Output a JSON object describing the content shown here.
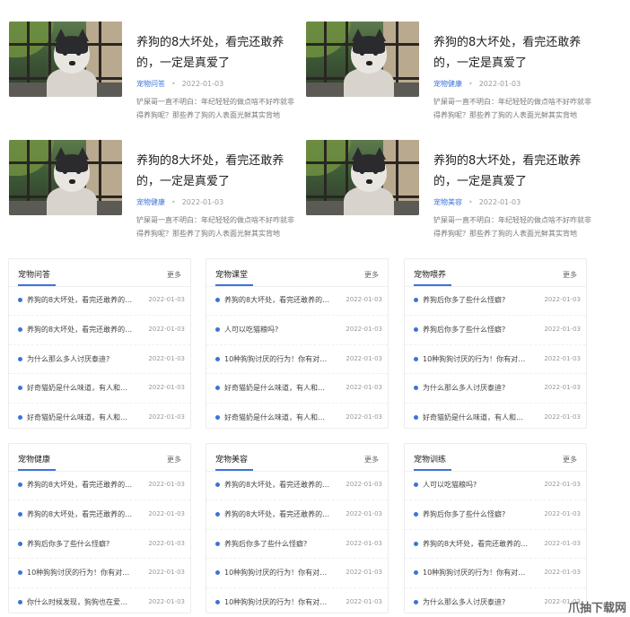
{
  "articles": [
    {
      "title": "养狗的8大坏处，看完还敢养的，一定是真爱了",
      "tag": "宠物问答",
      "date": "2022-01-03",
      "desc": "铲屎哥一直不明白：年纪轻轻的做点啥不好咋就非得养狗呢？那些养了狗的人表面光鲜其实背地"
    },
    {
      "title": "养狗的8大坏处，看完还敢养的，一定是真爱了",
      "tag": "宠物健康",
      "date": "2022-01-03",
      "desc": "铲屎哥一直不明白：年纪轻轻的做点啥不好咋就非得养狗呢？那些养了狗的人表面光鲜其实背地"
    },
    {
      "title": "养狗的8大坏处，看完还敢养的，一定是真爱了",
      "tag": "宠物健康",
      "date": "2022-01-03",
      "desc": "铲屎哥一直不明白：年纪轻轻的做点啥不好咋就非得养狗呢？那些养了狗的人表面光鲜其实背地"
    },
    {
      "title": "养狗的8大坏处，看完还敢养的，一定是真爱了",
      "tag": "宠物美容",
      "date": "2022-01-03",
      "desc": "铲屎哥一直不明白：年纪轻轻的做点啥不好咋就非得养狗呢？那些养了狗的人表面光鲜其实背地"
    }
  ],
  "more_label": "更多",
  "categories": [
    {
      "name": "宠物问答",
      "items": [
        {
          "text": "养狗的8大坏处，看完还敢养的，一...",
          "date": "2022-01-03"
        },
        {
          "text": "养狗的8大坏处，看完还敢养的，一...",
          "date": "2022-01-03"
        },
        {
          "text": "为什么那么多人讨厌泰迪?",
          "date": "2022-01-03"
        },
        {
          "text": "好奇猫奶是什么味道，有人和我一样...",
          "date": "2022-01-03"
        },
        {
          "text": "好奇猫奶是什么味道，有人和我一样...",
          "date": "2022-01-03"
        }
      ]
    },
    {
      "name": "宠物课堂",
      "items": [
        {
          "text": "养狗的8大坏处，看完还敢养的，一...",
          "date": "2022-01-03"
        },
        {
          "text": "人可以吃猫粮吗?",
          "date": "2022-01-03"
        },
        {
          "text": "10种狗狗讨厌的行为！你有对狗狗...",
          "date": "2022-01-03"
        },
        {
          "text": "好奇猫奶是什么味道，有人和我一样...",
          "date": "2022-01-03"
        },
        {
          "text": "好奇猫奶是什么味道，有人和我一样...",
          "date": "2022-01-03"
        }
      ]
    },
    {
      "name": "宠物喂养",
      "items": [
        {
          "text": "养狗后你多了些什么怪癖?",
          "date": "2022-01-03"
        },
        {
          "text": "养狗后你多了些什么怪癖?",
          "date": "2022-01-03"
        },
        {
          "text": "10种狗狗讨厌的行为！你有对狗狗...",
          "date": "2022-01-03"
        },
        {
          "text": "为什么那么多人讨厌泰迪?",
          "date": "2022-01-03"
        },
        {
          "text": "好奇猫奶是什么味道，有人和我一样...",
          "date": "2022-01-03"
        }
      ]
    },
    {
      "name": "宠物健康",
      "items": [
        {
          "text": "养狗的8大坏处，看完还敢养的，一...",
          "date": "2022-01-03"
        },
        {
          "text": "养狗的8大坏处，看完还敢养的，一...",
          "date": "2022-01-03"
        },
        {
          "text": "养狗后你多了些什么怪癖?",
          "date": "2022-01-03"
        },
        {
          "text": "10种狗狗讨厌的行为！你有对狗狗...",
          "date": "2022-01-03"
        },
        {
          "text": "你什么时候发现，狗狗也在爱着你?",
          "date": "2022-01-03"
        }
      ]
    },
    {
      "name": "宠物美容",
      "items": [
        {
          "text": "养狗的8大坏处，看完还敢养的，一...",
          "date": "2022-01-03"
        },
        {
          "text": "养狗的8大坏处，看完还敢养的，一...",
          "date": "2022-01-03"
        },
        {
          "text": "养狗后你多了些什么怪癖?",
          "date": "2022-01-03"
        },
        {
          "text": "10种狗狗讨厌的行为！你有对狗狗...",
          "date": "2022-01-03"
        },
        {
          "text": "10种狗狗讨厌的行为！你有对狗狗...",
          "date": "2022-01-03"
        }
      ]
    },
    {
      "name": "宠物训练",
      "items": [
        {
          "text": "人可以吃猫粮吗?",
          "date": "2022-01-03"
        },
        {
          "text": "养狗后你多了些什么怪癖?",
          "date": "2022-01-03"
        },
        {
          "text": "养狗的8大坏处，看完还敢养的，一...",
          "date": "2022-01-03"
        },
        {
          "text": "10种狗狗讨厌的行为！你有对狗狗...",
          "date": "2022-01-03"
        },
        {
          "text": "为什么那么多人讨厌泰迪?",
          "date": "2022-01-03"
        }
      ]
    }
  ],
  "watermark": "爪抽下载网",
  "colors": {
    "accent": "#3b74d8"
  }
}
